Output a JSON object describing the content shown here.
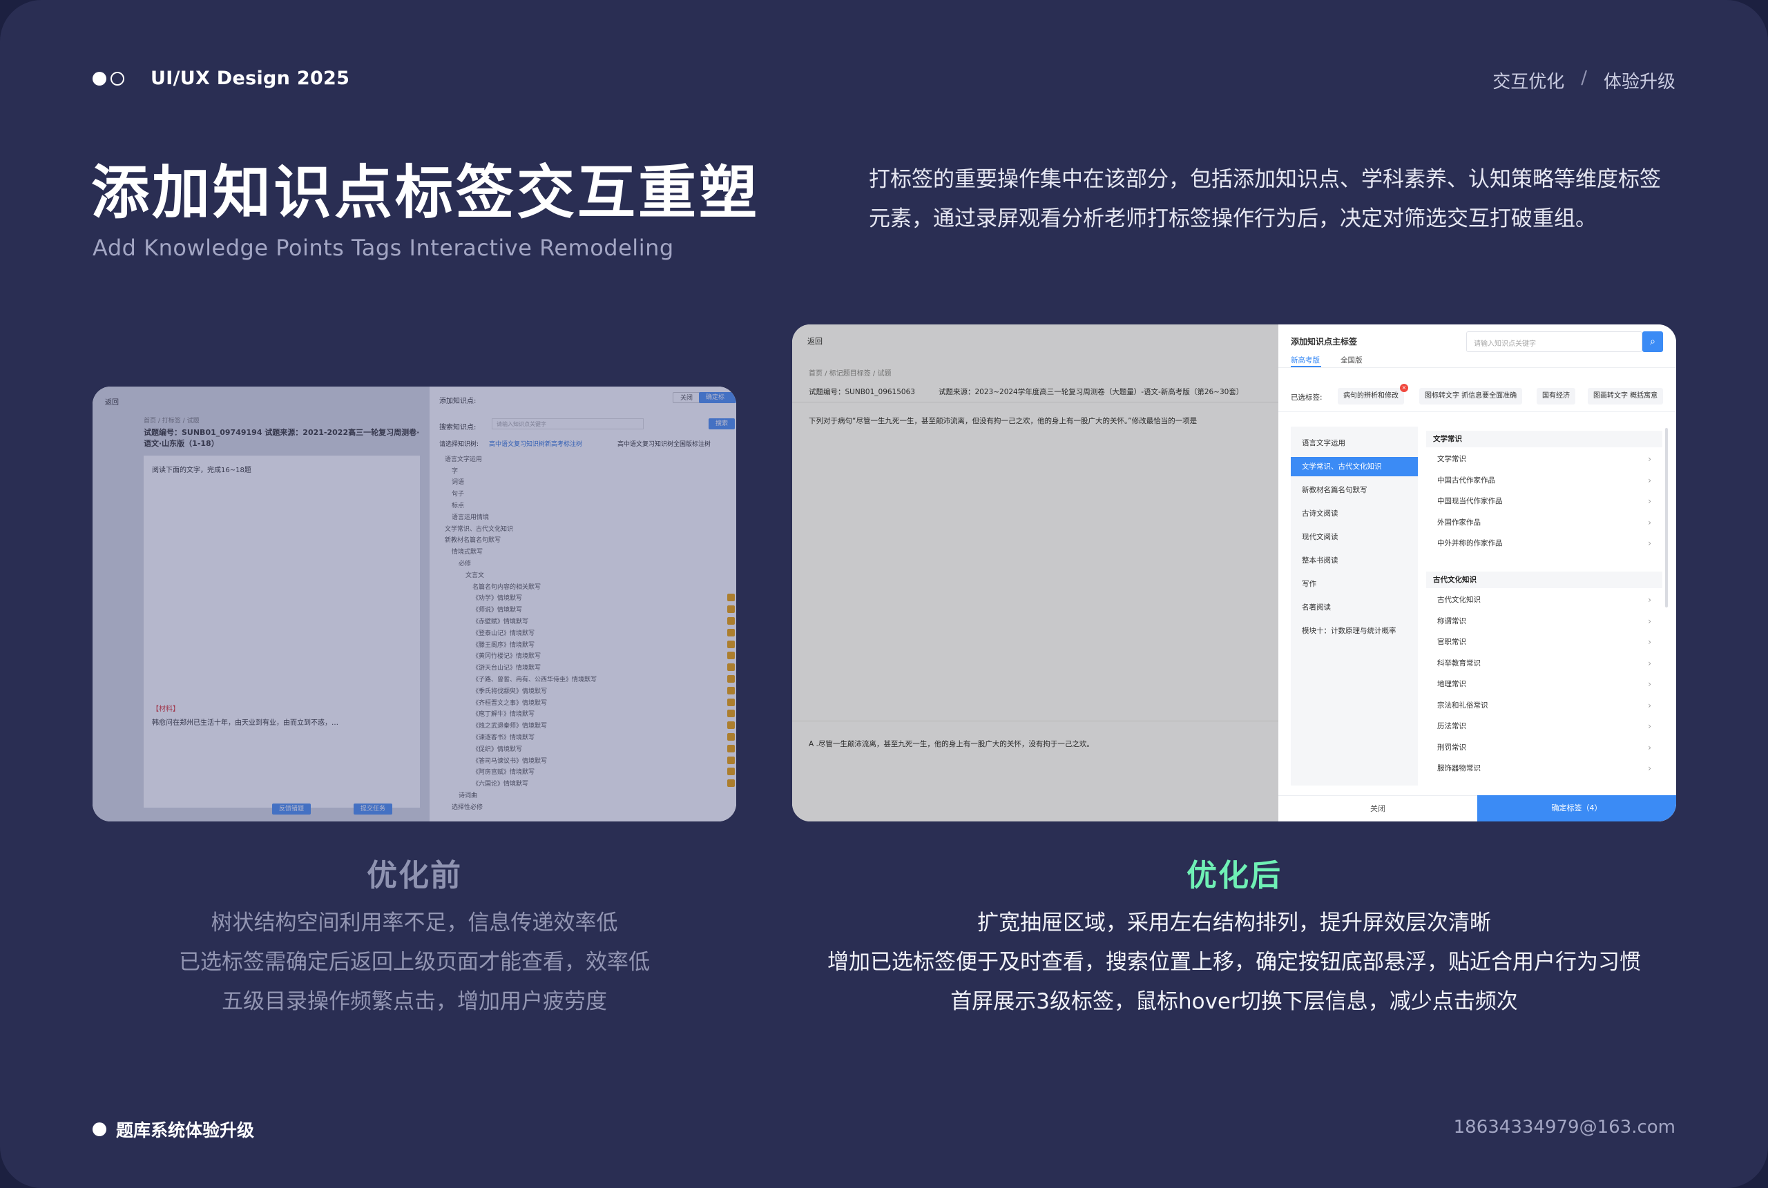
{
  "header": {
    "brand": "UI/UX Design 2025",
    "crumb1": "交互优化",
    "sep": "/",
    "crumb2": "体验升级"
  },
  "title": "添加知识点标签交互重塑",
  "subtitle": "Add Knowledge Points Tags Interactive Remodeling",
  "intro": "打标签的重要操作集中在该部分，包括添加知识点、学科素养、认知策略等维度标签元素，通过录屏观看分析老师打标签操作行为后，决定对筛选交互打破重组。",
  "before_mock": {
    "back": "返回",
    "breadcrumb": "首页 / 打标签 / 试题",
    "question_no": "试题编号：SUNB01_09749194  试题来源：2021-2022高三一轮复习周测卷·语文·山东版（1-18）",
    "prompt": "阅读下面的文字，完成16~18题",
    "material_label": "【材料】",
    "material_text": "韩愈问在郑州已生活十年，由天业到有业，由而立到不惑，…",
    "feedback_btn": "反馈错题",
    "submit_btn": "提交任务",
    "drawer_title": "添加知识点:",
    "close_btn": "关闭",
    "ok_btn": "确定标签",
    "search_label": "搜索知识点:",
    "search_placeholder": "请输入知识点关键字",
    "search_btn": "搜索",
    "choose_label": "请选择知识树:",
    "radio1": "高中语文复习知识树新高考标注树",
    "radio2": "高中语文复习知识树全国版标注树",
    "tree": [
      "语言文字运用",
      "字",
      "词语",
      "句子",
      "标点",
      "语言运用情境",
      "文学常识、古代文化知识",
      "新教材名篇名句默写",
      "情境式默写",
      "必修",
      "文言文",
      "名篇名句内容的相关默写",
      "《劝学》情境默写",
      "《师说》情境默写",
      "《赤壁赋》情境默写",
      "《登泰山记》情境默写",
      "《滕王阁序》情境默写",
      "《黄冈竹楼记》情境默写",
      "《游天台山记》情境默写",
      "《子路、曾皙、冉有、公西华侍坐》情境默写",
      "《季氏将伐颛臾》情境默写",
      "《齐桓晋文之事》情境默写",
      "《庖丁解牛》情境默写",
      "《烛之武退秦师》情境默写",
      "《谏逐客书》情境默写",
      "《促织》情境默写",
      "《答司马谏议书》情境默写",
      "《阿房宫赋》情境默写",
      "《六国论》情境默写",
      "诗词曲",
      "选择性必修"
    ]
  },
  "after_mock": {
    "back": "返回",
    "breadcrumb": "首页 / 标记题目标签 / 试题",
    "question_no": "试题编号：SUNB01_09615063",
    "question_src": "试题来源：2023~2024学年度高三一轮复习周测卷（大题量）-语文-新高考版（第26~30套）",
    "stem": "下列对于病句“尽管一生九死一生，甚至颠沛流离，但没有拘一己之欢，他的身上有一股广大的关怀。”修改最恰当的一项是",
    "option_a": "A .尽管一生颠沛流离，甚至九死一生，他的身上有一股广大的关怀，没有拘于一己之欢。",
    "drawer_title": "添加知识点主标签",
    "search_placeholder": "请输入知识点关键字",
    "tabs": [
      "新高考版",
      "全国版"
    ],
    "selected_label": "已选标签:",
    "selected_tags": [
      "病句的辨析和修改",
      "图标转文字 抓信息要全面准确",
      "国有经济",
      "图画转文字 概括寓意"
    ],
    "categories": [
      "语言文字运用",
      "文学常识、古代文化知识",
      "新教材名篇名句默写",
      "古诗文阅读",
      "现代文阅读",
      "整本书阅读",
      "写作",
      "名著阅读",
      "模块十：计数原理与统计概率"
    ],
    "group1_title": "文学常识",
    "group1_items": [
      "文学常识",
      "中国古代作家作品",
      "中国现当代作家作品",
      "外国作家作品",
      "中外并称的作家作品"
    ],
    "group2_title": "古代文化知识",
    "group2_items": [
      "古代文化知识",
      "称谓常识",
      "官职常识",
      "科举教育常识",
      "地理常识",
      "宗法和礼俗常识",
      "历法常识",
      "刑罚常识",
      "服饰器物常识"
    ],
    "close_btn": "关闭",
    "ok_btn": "确定标签（4）"
  },
  "before": {
    "caption": "优化前",
    "lines": [
      "树状结构空间利用率不足，信息传递效率低",
      "已选标签需确定后返回上级页面才能查看，效率低",
      "五级目录操作频繁点击，增加用户疲劳度"
    ]
  },
  "after": {
    "caption": "优化后",
    "lines": [
      "扩宽抽屉区域，采用左右结构排列，提升屏效层次清晰",
      "增加已选标签便于及时查看，搜索位置上移，确定按钮底部悬浮，贴近合用户行为习惯",
      "首屏展示3级标签，鼠标hover切换下层信息，减少点击频次"
    ]
  },
  "footer": {
    "left": "题库系统体验升级",
    "right": "18634334979@163.com"
  },
  "colors": {
    "background": "#2a2e53",
    "accent_green": "#6ff0b5",
    "primary_blue": "#3b8bf5",
    "muted": "#9396b3"
  }
}
